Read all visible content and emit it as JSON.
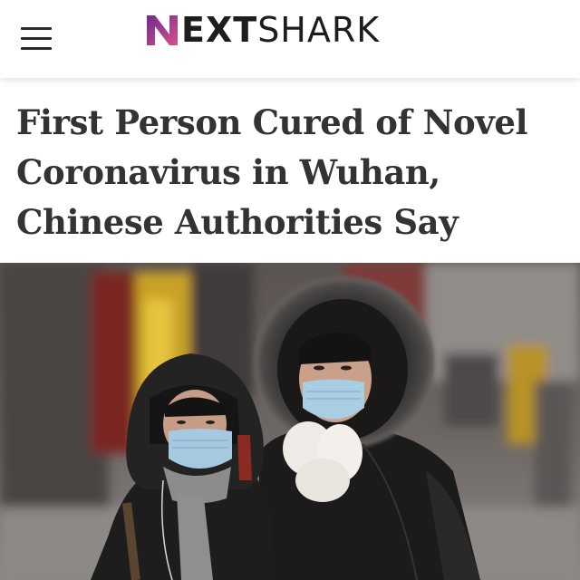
{
  "header": {
    "logo": {
      "part1": "NEXT",
      "part2": "SHARK"
    },
    "menu_icon": "hamburger-menu-icon"
  },
  "article": {
    "headline_lines": [
      "First Person Cured of Novel",
      "Coronavirus in Wuhan,",
      "Chinese Authorities Say"
    ]
  },
  "colors": {
    "logo_gradient_start": "#7b2d8f",
    "logo_gradient_end": "#d24b8b",
    "text": "#333333",
    "header_bg": "#ffffff"
  }
}
